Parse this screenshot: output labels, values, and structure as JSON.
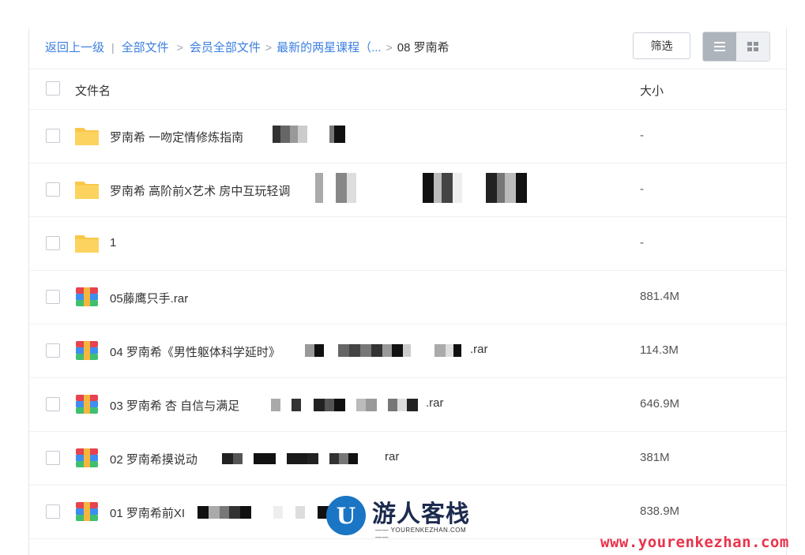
{
  "breadcrumb": {
    "back": "返回上一级",
    "divider": "|",
    "sep": ">",
    "items": [
      "全部文件",
      "会员全部文件",
      "最新的两星课程（..."
    ],
    "current": "08 罗南希"
  },
  "toolbar": {
    "filter_label": "筛选",
    "view_mode": "list"
  },
  "table": {
    "col_name": "文件名",
    "col_size": "大小"
  },
  "files": [
    {
      "name": "罗南希 一吻定情修炼指南",
      "ext": "",
      "size": "-",
      "type": "folder"
    },
    {
      "name": "罗南希 高阶前X艺术 房中互玩轻调",
      "ext": "",
      "size": "-",
      "type": "folder"
    },
    {
      "name": "1",
      "ext": "",
      "size": "-",
      "type": "folder"
    },
    {
      "name": "05藤鹰只手.rar",
      "ext": "",
      "size": "881.4M",
      "type": "rar"
    },
    {
      "name": "04 罗南希《男性躯体科学延时》",
      "ext": ".rar",
      "size": "114.3M",
      "type": "rar"
    },
    {
      "name": "03 罗南希 杏 自信与满足",
      "ext": ".rar",
      "size": "646.9M",
      "type": "rar"
    },
    {
      "name": "02 罗南希摸说动",
      "ext": "rar",
      "size": "381M",
      "type": "rar"
    },
    {
      "name": "01 罗南希前XI",
      "ext": "",
      "size": "838.9M",
      "type": "rar"
    }
  ],
  "watermark": {
    "logo_glyph": "U",
    "logo_text": "游人客栈",
    "logo_sub": "—— YOURENKEZHAN.COM ——",
    "url": "www.yourenkezhan.com"
  },
  "colors": {
    "link": "#3b7fe0",
    "folder": "#f9c84a",
    "watermark_url": "#e8334a",
    "logo_blue": "#1a75c4"
  },
  "icons": [
    "folder-icon",
    "archive-icon",
    "list-view-icon",
    "grid-view-icon"
  ]
}
